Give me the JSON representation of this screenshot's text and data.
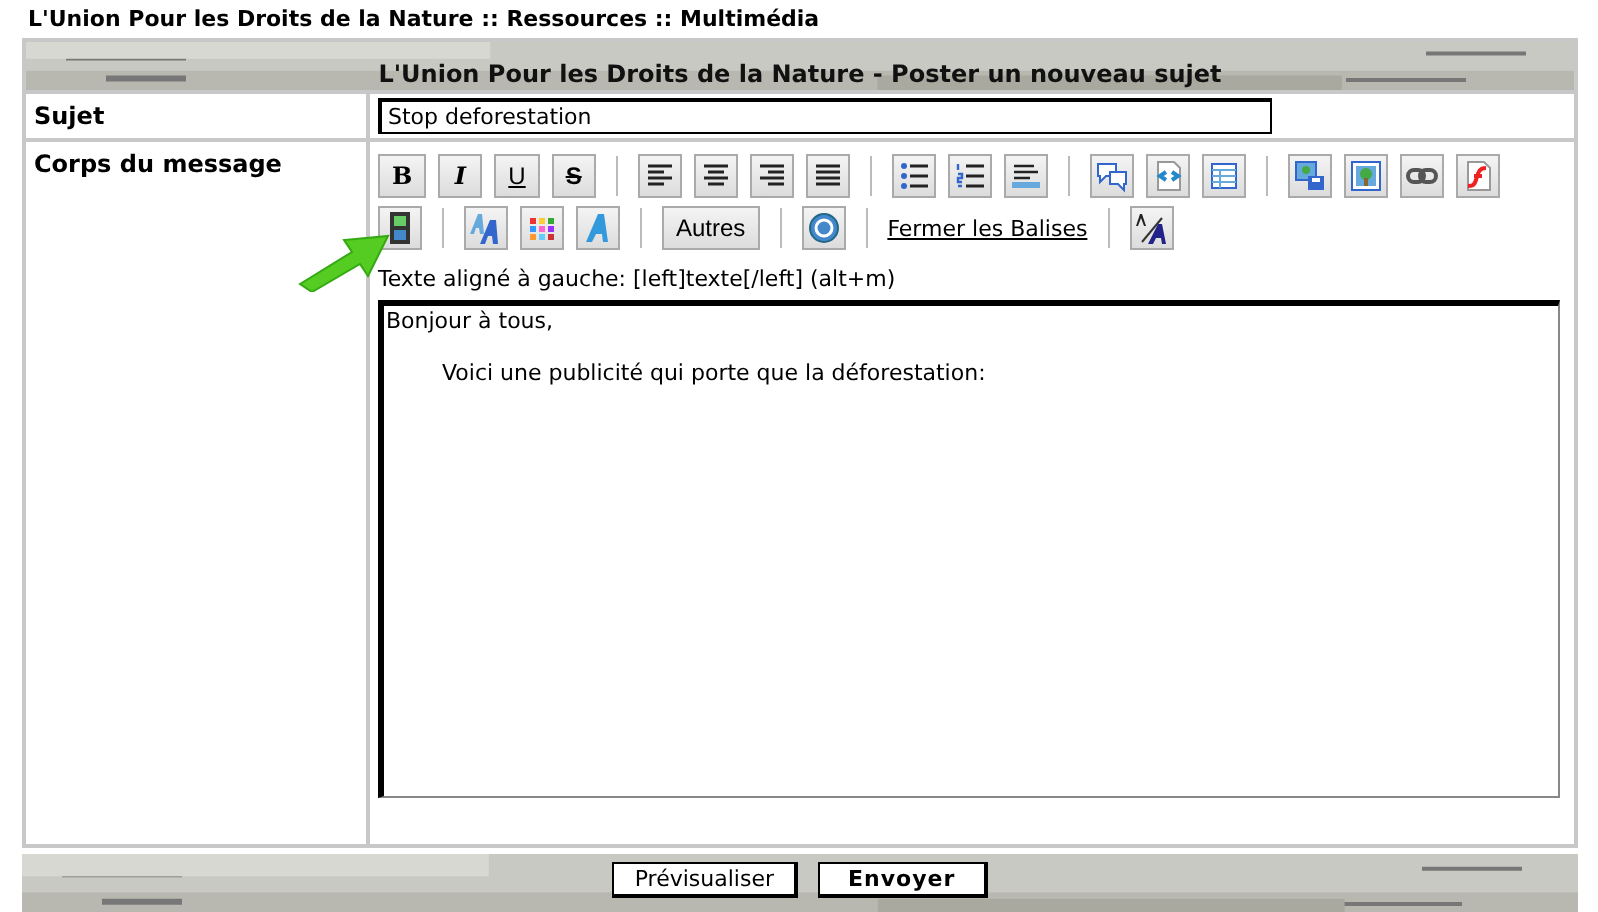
{
  "breadcrumb": "L'Union Pour les Droits de la Nature  :: Ressources :: Multimédia",
  "form_title": "L'Union Pour les Droits de la Nature - Poster un nouveau sujet",
  "subject": {
    "label": "Sujet",
    "value": "Stop deforestation"
  },
  "body": {
    "label": "Corps du message",
    "toolbar_rows": [
      [
        [
          {
            "kind": "text",
            "label": "B"
          },
          {
            "kind": "text",
            "label": "I"
          },
          {
            "kind": "text",
            "label": "U"
          },
          {
            "kind": "text",
            "label": "S"
          }
        ],
        [
          {
            "kind": "icon"
          },
          {
            "kind": "icon"
          },
          {
            "kind": "icon"
          },
          {
            "kind": "icon"
          }
        ],
        [
          {
            "kind": "icon"
          },
          {
            "kind": "icon"
          },
          {
            "kind": "icon"
          }
        ],
        [
          {
            "kind": "icon"
          },
          {
            "kind": "icon"
          },
          {
            "kind": "icon"
          }
        ],
        [
          {
            "kind": "icon"
          },
          {
            "kind": "icon"
          },
          {
            "kind": "icon"
          },
          {
            "kind": "icon"
          }
        ]
      ],
      [
        [
          {
            "kind": "icon"
          }
        ],
        [
          {
            "kind": "icon"
          },
          {
            "kind": "icon"
          },
          {
            "kind": "icon"
          }
        ],
        [
          {
            "kind": "text",
            "label": "Autres"
          }
        ],
        [
          {
            "kind": "icon"
          }
        ],
        [
          {
            "kind": "link",
            "label": "Fermer les Balises"
          }
        ],
        [
          {
            "kind": "icon"
          }
        ]
      ]
    ],
    "hint": "Texte aligné à gauche: [left]texte[/left] (alt+m)",
    "value": "Bonjour à tous,\n\n\tVoici une publicité qui porte que la déforestation:\n\n"
  },
  "buttons": [
    {
      "label": "Prévisualiser",
      "primary": false
    },
    {
      "label": "Envoyer",
      "primary": true
    }
  ]
}
